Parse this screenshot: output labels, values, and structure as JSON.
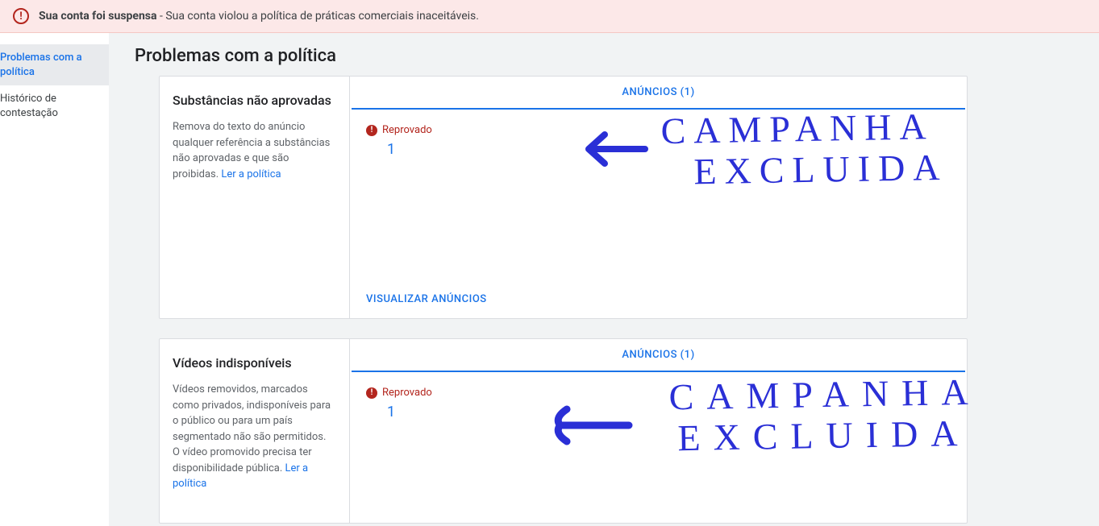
{
  "alert": {
    "title": "Sua conta foi suspensa",
    "separator": " - ",
    "message": "Sua conta violou a política de práticas comerciais inaceitáveis."
  },
  "sidebar": {
    "items": [
      {
        "label": "Problemas com a política",
        "active": true
      },
      {
        "label": "Histórico de contestação",
        "active": false
      }
    ]
  },
  "page": {
    "title": "Problemas com a política"
  },
  "cards": [
    {
      "title": "Substâncias não aprovadas",
      "desc": "Remova do texto do anúncio qualquer referência a substâncias não aprovadas e que são proibidas. ",
      "policy_link": "Ler a política",
      "tab_label": "ANÚNCIOS (1)",
      "status_label": "Reprovado",
      "status_count": "1",
      "view_link": "VISUALIZAR ANÚNCIOS"
    },
    {
      "title": "Vídeos indisponíveis",
      "desc": "Vídeos removidos, marcados como privados, indisponíveis para o público ou para um país segmentado não são permitidos. O vídeo promovido precisa ter disponibilidade pública. ",
      "policy_link": "Ler a política",
      "tab_label": "ANÚNCIOS (1)",
      "status_label": "Reprovado",
      "status_count": "1",
      "view_link": ""
    }
  ],
  "annotations": {
    "line1": "CAMPANHA",
    "line2": "EXCLUIDA"
  }
}
